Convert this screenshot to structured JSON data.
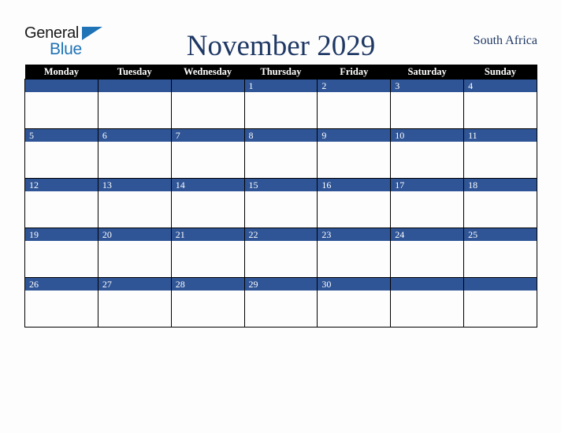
{
  "brand": {
    "name_part1": "General",
    "name_part2": "Blue",
    "flag_icon": "triangle-flag-icon",
    "color_black": "#1a1a1a",
    "color_blue": "#1f73b7"
  },
  "header": {
    "title": "November 2029",
    "month": "November",
    "year": "2029",
    "country": "South Africa",
    "title_color": "#1f3864"
  },
  "calendar": {
    "header_background": "#000000",
    "header_text_color": "#ffffff",
    "day_bar_color": "#2f5597",
    "day_number_color": "#ffffff",
    "cell_background": "#fdfdfd",
    "border_color": "#000000",
    "weekdays": [
      "Monday",
      "Tuesday",
      "Wednesday",
      "Thursday",
      "Friday",
      "Saturday",
      "Sunday"
    ],
    "weeks": [
      [
        "",
        "",
        "",
        "1",
        "2",
        "3",
        "4"
      ],
      [
        "5",
        "6",
        "7",
        "8",
        "9",
        "10",
        "11"
      ],
      [
        "12",
        "13",
        "14",
        "15",
        "16",
        "17",
        "18"
      ],
      [
        "19",
        "20",
        "21",
        "22",
        "23",
        "24",
        "25"
      ],
      [
        "26",
        "27",
        "28",
        "29",
        "30",
        "",
        ""
      ]
    ]
  }
}
